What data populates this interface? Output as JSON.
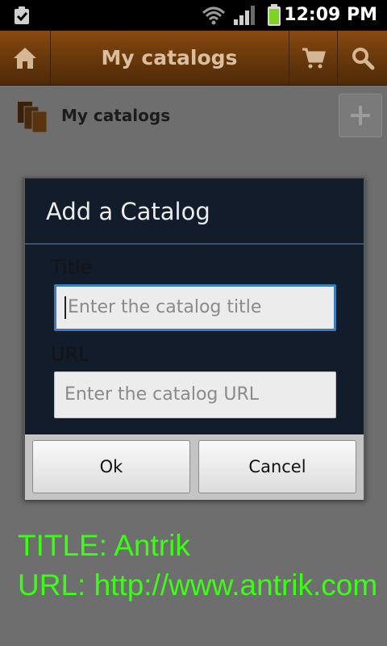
{
  "status_bar": {
    "time": "12:09 PM",
    "icons": [
      "clipboard-check-icon",
      "wifi-icon",
      "signal-icon",
      "battery-icon"
    ]
  },
  "action_bar": {
    "title": "My catalogs",
    "icons": [
      "home-icon",
      "cart-icon",
      "search-icon"
    ],
    "color": "#6b3a0c"
  },
  "list_header": {
    "label": "My catalogs",
    "icon": "catalogs-stack-icon",
    "add_button_icon": "plus-icon"
  },
  "dialog": {
    "title": "Add a Catalog",
    "fields": {
      "title": {
        "label": "Title",
        "value": "",
        "placeholder": "Enter the catalog title"
      },
      "url": {
        "label": "URL",
        "value": "",
        "placeholder": "Enter the catalog URL"
      }
    },
    "buttons": {
      "ok": "Ok",
      "cancel": "Cancel"
    }
  },
  "caption": {
    "line1": "TITLE: Antrik",
    "line2": "URL: http://www.antrik.com",
    "color": "#39ff14"
  }
}
